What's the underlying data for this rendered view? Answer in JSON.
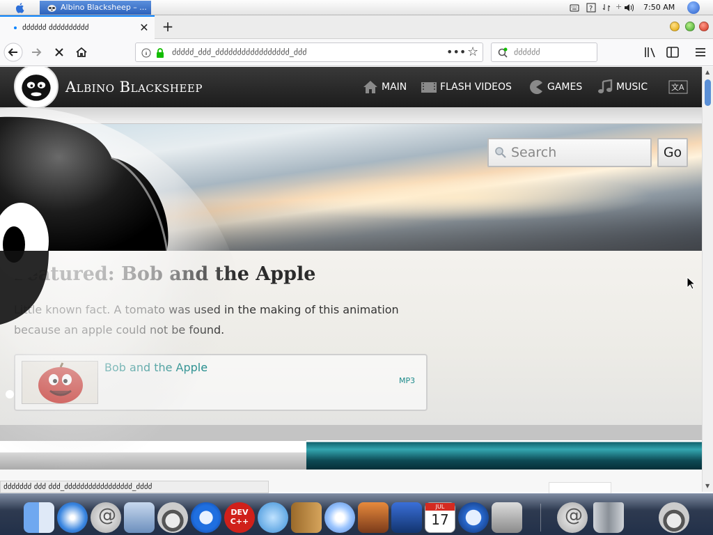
{
  "menubar": {
    "active_app_title": "Albino Blacksheep – ...",
    "clock": "7:50 AM"
  },
  "browser": {
    "tab_title": "ძძძძძძ ძძძძძძძძძძ",
    "url_text": "ძძძძძ_ძძძ_ძძძძძძძძძძძძძძძძძ_ძძძ",
    "search_placeholder": "ძძძძძძ",
    "status_text": "ძძძძძძძ ძძძ ძძძ_ძძძძძძძძძძძძძძძძძ_ძძძძ"
  },
  "site": {
    "name": "Albino Blacksheep",
    "nav": [
      {
        "label": "MAIN",
        "icon": "home-icon"
      },
      {
        "label": "FLASH VIDEOS",
        "icon": "film-icon"
      },
      {
        "label": "GAMES",
        "icon": "pacman-icon"
      },
      {
        "label": "MUSIC",
        "icon": "music-note-icon"
      }
    ],
    "search_placeholder": "Search",
    "go_label": "Go"
  },
  "feature": {
    "title": "Featured: Bob and the Apple",
    "description": "Little known fact. A tomato was used in the making of this animation because an apple could not be found.",
    "media": {
      "title": "Bob and the Apple",
      "format": "MP3"
    }
  },
  "dock": {
    "items": [
      "finder-icon",
      "safari-icon",
      "mail-icon",
      "preview-icon",
      "raccoon-icon",
      "chrome-icon",
      "devcpp-icon",
      "ichat-icon",
      "address-book-icon",
      "itunes-icon",
      "iphoto-icon",
      "imovie-icon",
      "ical-icon",
      "quicktime-icon",
      "system-preferences-icon",
      "mail-stamp-icon",
      "trash-icon",
      "raccoon-icon"
    ],
    "ical_day": "17",
    "ical_month": "JUL",
    "devcpp_label": "DEV C++"
  },
  "colors": {
    "accent_blue": "#0a84ff",
    "site_header": "#262626",
    "link_teal": "#1d8a8a"
  }
}
